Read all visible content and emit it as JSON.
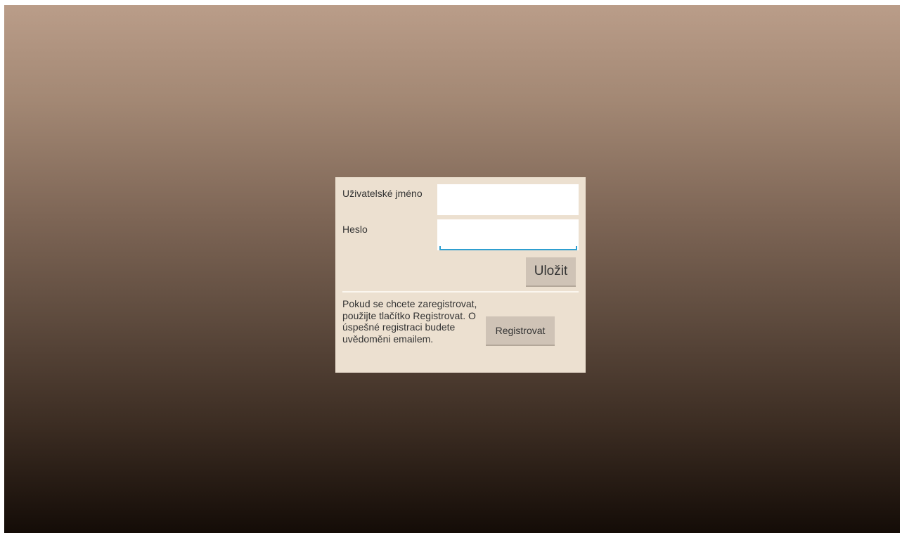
{
  "login_form": {
    "username_label": "Uživatelské jméno",
    "username_value": "",
    "password_label": "Heslo",
    "password_value": "",
    "save_label": "Uložit"
  },
  "registration": {
    "info_text": "Pokud se chcete zaregistrovat, použijte tlačítko Registrovat. O úspešné registraci budete uvědoměni emailem.",
    "register_label": "Registrovat"
  },
  "colors": {
    "dialog_background": "#ece0d0",
    "button_background": "#cfc3b6",
    "focus_accent": "#2e9fd0",
    "background_top": "#ba9d89",
    "background_bottom": "#140c07"
  }
}
